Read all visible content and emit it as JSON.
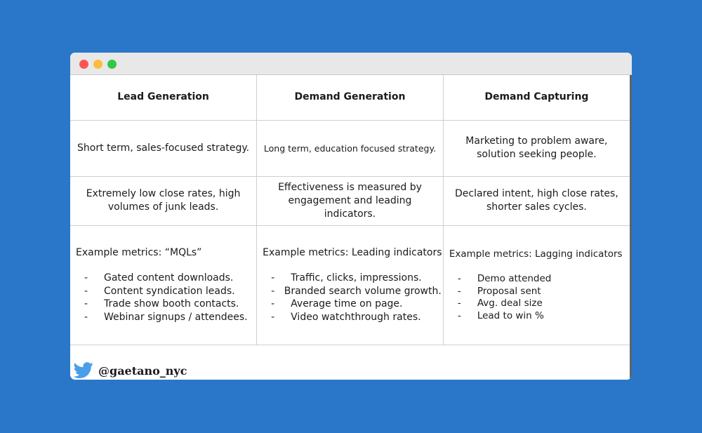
{
  "window": {
    "controls": {
      "close_color": "#fc5753",
      "minimize_color": "#fdbc40",
      "zoom_color": "#33c748"
    }
  },
  "table": {
    "headers": [
      "Lead Generation",
      "Demand Generation",
      "Demand Capturing"
    ],
    "strategy": [
      "Short term, sales-focused strategy.",
      "Long term, education focused strategy.",
      "Marketing to problem aware, solution seeking people."
    ],
    "characteristics": [
      "Extremely low close rates, high volumes of junk leads.",
      "Effectiveness is measured by engagement and leading indicators.",
      "Declared intent, high close rates, shorter sales cycles."
    ],
    "metrics": [
      {
        "title": "Example metrics: “MQLs”",
        "bullet": "-",
        "items": [
          "Gated content downloads.",
          "Content syndication leads.",
          "Trade show booth contacts.",
          "Webinar signups / attendees."
        ]
      },
      {
        "title": "Example metrics: Leading indicators",
        "bullet": "-",
        "items": [
          "Traffic, clicks, impressions.",
          "Branded search volume growth.",
          "Average time on page.",
          "Video watchthrough rates."
        ]
      },
      {
        "title": "Example metrics: Lagging indicators",
        "bullet": "-",
        "items": [
          "Demo attended",
          "Proposal sent",
          "Avg. deal size",
          "Lead to win %"
        ]
      }
    ]
  },
  "footer": {
    "icon": "twitter-bird-icon",
    "icon_color": "#4a9ee8",
    "handle": "@gaetano_nyc"
  },
  "colors": {
    "background": "#2a77c9",
    "titlebar": "#e8e8e8",
    "grid_line": "#cfcfcf"
  }
}
